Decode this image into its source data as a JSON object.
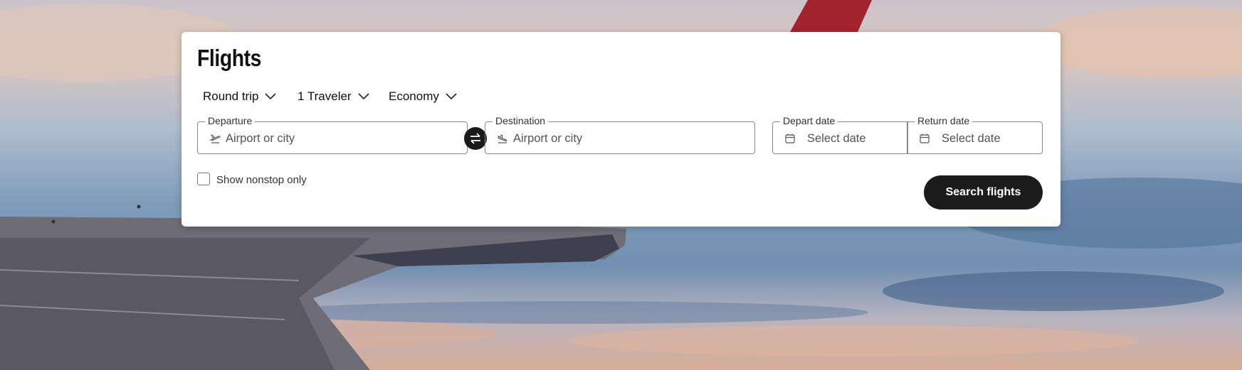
{
  "flights": {
    "title": "Flights",
    "trip_type": "Round trip",
    "travelers": "1 Traveler",
    "cabin": "Economy",
    "departure": {
      "label": "Departure",
      "placeholder": "Airport or city"
    },
    "destination": {
      "label": "Destination",
      "placeholder": "Airport or city"
    },
    "depart_date": {
      "label": "Depart date",
      "placeholder": "Select date"
    },
    "return_date": {
      "label": "Return date",
      "placeholder": "Select date"
    },
    "nonstop_label": "Show nonstop only",
    "search_label": "Search flights"
  },
  "icons": [
    "chevron-down-icon",
    "takeoff-icon",
    "landing-icon",
    "swap-icon",
    "calendar-icon"
  ],
  "colors": {
    "button": "#1c1c1c",
    "card": "#ffffff",
    "tail": "#a3232f"
  }
}
